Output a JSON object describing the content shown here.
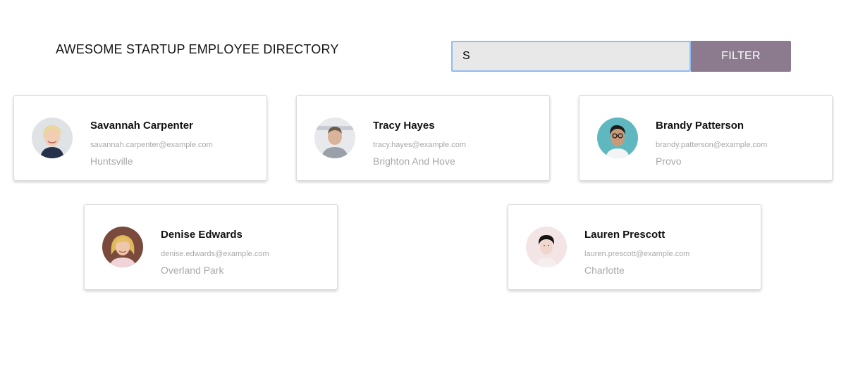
{
  "header": {
    "title": "AWESOME STARTUP EMPLOYEE DIRECTORY"
  },
  "search": {
    "value": "S",
    "placeholder": "",
    "button_label": "FILTER"
  },
  "employees": [
    {
      "name": "Savannah Carpenter",
      "email": "savannah.carpenter@example.com",
      "city": "Huntsville",
      "avatar_icon": "woman-blonde-short-hair-avatar"
    },
    {
      "name": "Tracy Hayes",
      "email": "tracy.hayes@example.com",
      "city": "Brighton And Hove",
      "avatar_icon": "man-short-hair-avatar"
    },
    {
      "name": "Brandy Patterson",
      "email": "brandy.patterson@example.com",
      "city": "Provo",
      "avatar_icon": "woman-glasses-teal-background-avatar"
    },
    {
      "name": "Denise Edwards",
      "email": "denise.edwards@example.com",
      "city": "Overland Park",
      "avatar_icon": "woman-blonde-long-hair-avatar"
    },
    {
      "name": "Lauren Prescott",
      "email": "lauren.prescott@example.com",
      "city": "Charlotte",
      "avatar_icon": "man-dark-hair-light-background-avatar"
    }
  ],
  "colors": {
    "filter_button": "#8c7b8e",
    "input_background": "#e8e8e8",
    "input_focus_border": "#8fbcf2",
    "secondary_text": "#a9a9a9"
  }
}
